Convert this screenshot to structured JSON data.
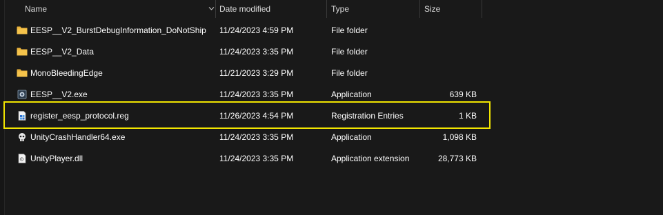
{
  "columns": {
    "name": "Name",
    "date": "Date modified",
    "type": "Type",
    "size": "Size"
  },
  "files": [
    {
      "name": "EESP__V2_BurstDebugInformation_DoNotShip",
      "date": "11/24/2023 4:59 PM",
      "type": "File folder",
      "size": "",
      "icon": "folder-icon"
    },
    {
      "name": "EESP__V2_Data",
      "date": "11/24/2023 3:35 PM",
      "type": "File folder",
      "size": "",
      "icon": "folder-icon"
    },
    {
      "name": "MonoBleedingEdge",
      "date": "11/21/2023 3:29 PM",
      "type": "File folder",
      "size": "",
      "icon": "folder-icon"
    },
    {
      "name": "EESP__V2.exe",
      "date": "11/24/2023 3:35 PM",
      "type": "Application",
      "size": "639 KB",
      "icon": "unity-app-icon"
    },
    {
      "name": "register_eesp_protocol.reg",
      "date": "11/26/2023 4:54 PM",
      "type": "Registration Entries",
      "size": "1 KB",
      "icon": "registry-file-icon"
    },
    {
      "name": "UnityCrashHandler64.exe",
      "date": "11/24/2023 3:35 PM",
      "type": "Application",
      "size": "1,098 KB",
      "icon": "crash-handler-icon"
    },
    {
      "name": "UnityPlayer.dll",
      "date": "11/24/2023 3:35 PM",
      "type": "Application extension",
      "size": "28,773 KB",
      "icon": "dll-file-icon"
    }
  ],
  "highlight_color": "#f2e600",
  "folder_color": "#f5c34b"
}
